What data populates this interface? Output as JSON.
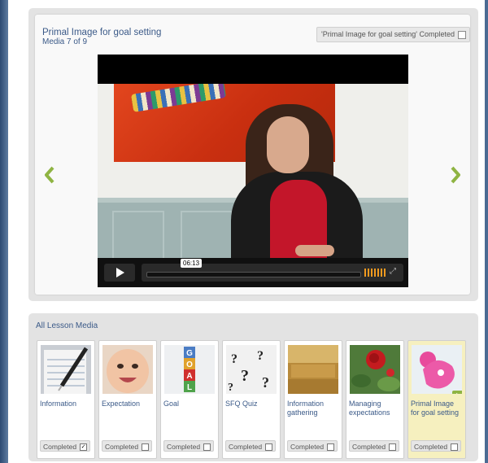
{
  "player": {
    "title": "Primal Image for goal setting",
    "counter": "Media 7 of 9",
    "complete_toggle": "'Primal Image for goal setting' Completed",
    "time": "06:13",
    "accent_color": "#8fb443"
  },
  "lesson": {
    "heading": "All Lesson Media",
    "items": [
      {
        "label": "Information",
        "status": "Completed",
        "checked": "✓",
        "icon": "notepad-pen-thumbnail"
      },
      {
        "label": "Expectation",
        "status": "Completed",
        "checked": "",
        "icon": "baby-face-thumbnail"
      },
      {
        "label": "Goal",
        "status": "Completed",
        "checked": "",
        "icon": "goal-blocks-thumbnail"
      },
      {
        "label": "SFQ Quiz",
        "status": "Completed",
        "checked": "",
        "icon": "question-marks-thumbnail"
      },
      {
        "label": "Information gathering",
        "status": "Completed",
        "checked": "",
        "icon": "hay-bales-thumbnail"
      },
      {
        "label": "Managing expectations",
        "status": "Completed",
        "checked": "",
        "icon": "red-rose-thumbnail"
      },
      {
        "label": "Primal Image for goal setting",
        "status": "Completed",
        "checked": "",
        "icon": "pink-toy-thumbnail"
      }
    ]
  }
}
